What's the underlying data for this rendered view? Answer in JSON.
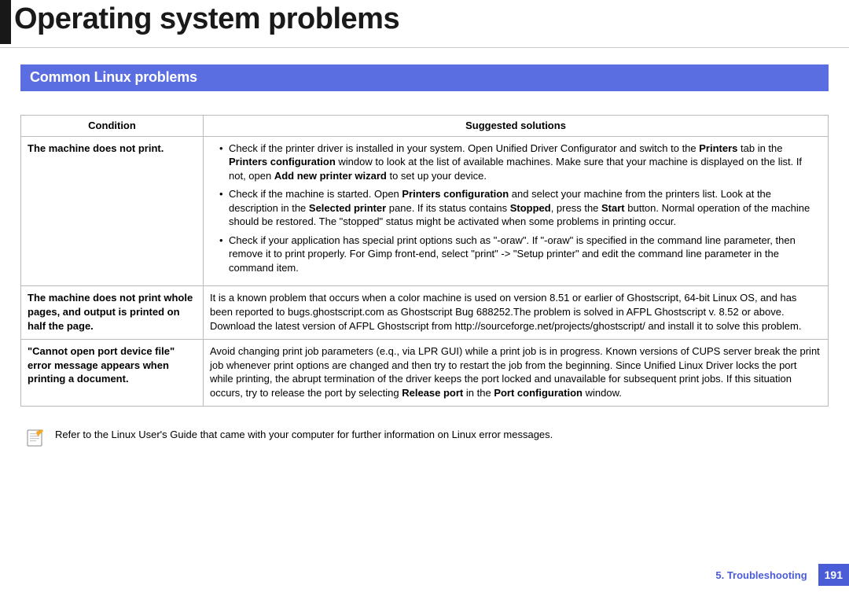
{
  "title": "Operating system problems",
  "section_heading": "Common Linux problems",
  "table": {
    "headers": {
      "condition": "Condition",
      "solutions": "Suggested solutions"
    },
    "rows": [
      {
        "condition": "The machine does not print.",
        "type": "list",
        "items": [
          {
            "pre": "Check if the printer driver is installed in your system. Open Unified Driver Configurator and switch to the ",
            "b1": "Printers",
            "mid1": " tab in the ",
            "b2": "Printers configuration",
            "mid2": " window to look at the list of available machines. Make sure that your machine is displayed on the list. If not, open ",
            "b3": "Add new printer wizard",
            "post": " to set up your device."
          },
          {
            "pre": "Check if the machine is started. Open ",
            "b1": "Printers configuration",
            "mid1": " and select your machine from the printers list. Look at the description in the ",
            "b2": "Selected printer",
            "mid2": " pane. If its status contains ",
            "b3": "Stopped",
            "mid3": ", press the ",
            "b4": "Start",
            "post": " button. Normal operation of the machine should be restored. The \"stopped\" status might be activated when some problems in printing occur."
          },
          {
            "pre": "Check if your application has special print options such as \"-oraw\". If \"-oraw\" is specified in the command line parameter, then remove it to print properly. For Gimp front-end, select \"print\" -> \"Setup printer\" and edit the command line parameter in the command item.",
            "b1": "",
            "mid1": "",
            "b2": "",
            "mid2": "",
            "b3": "",
            "mid3": "",
            "b4": "",
            "post": ""
          }
        ]
      },
      {
        "condition": "The machine does not print whole pages, and output is printed on half the page.",
        "type": "text",
        "text": "It is a known problem that occurs when a color machine is used on version 8.51 or earlier of Ghostscript, 64-bit Linux OS, and has been reported to bugs.ghostscript.com as Ghostscript Bug 688252.The problem is solved in AFPL Ghostscript v. 8.52 or above. Download the latest version of AFPL Ghostscript from http://sourceforge.net/projects/ghostscript/ and install it to solve this problem."
      },
      {
        "condition": "\"Cannot open port device file\" error message appears when printing a document.",
        "type": "richtext",
        "pre": "Avoid changing print job parameters (e.q., via LPR GUI) while a print job is in progress. Known versions of CUPS server break the print job whenever print options are changed and then try to restart the job from the beginning. Since Unified Linux Driver locks the port while printing, the abrupt termination of the driver keeps the port locked and unavailable for subsequent print jobs. If this situation occurs, try to release the port by selecting ",
        "b1": "Release port",
        "mid1": " in the ",
        "b2": "Port configuration",
        "post": " window."
      }
    ]
  },
  "note": "Refer to the Linux User's Guide that came with your computer for further information on Linux error messages.",
  "footer": {
    "chapter": "5.  Troubleshooting",
    "page": "191"
  }
}
